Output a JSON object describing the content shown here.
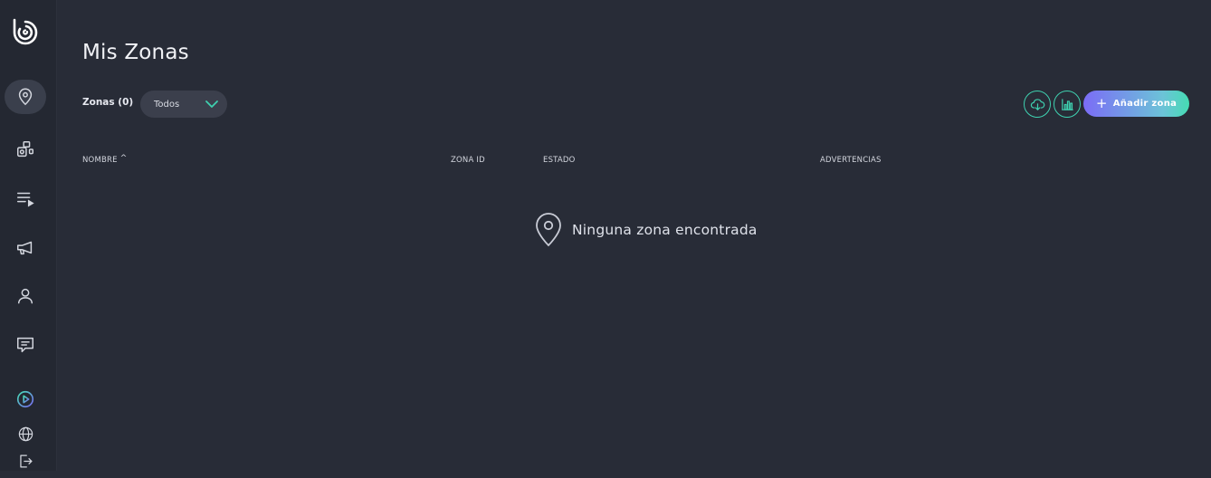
{
  "sidebar": {
    "logo": "brand-logo",
    "items": [
      {
        "name": "zones",
        "icon": "map-pin-icon",
        "active": true
      },
      {
        "name": "devices",
        "icon": "devices-icon",
        "active": false
      },
      {
        "name": "playlists",
        "icon": "playlist-icon",
        "active": false
      },
      {
        "name": "announcements",
        "icon": "megaphone-icon",
        "active": false
      },
      {
        "name": "account",
        "icon": "user-icon",
        "active": false
      },
      {
        "name": "messages",
        "icon": "message-icon",
        "active": false
      }
    ],
    "bottom": [
      "play-icon",
      "globe-icon",
      "logout-icon"
    ]
  },
  "page": {
    "title": "Mis Zonas"
  },
  "toolbar": {
    "zones_label": "Zonas (0)",
    "filter_value": "Todos",
    "download_icon": "cloud-download-icon",
    "stats_icon": "bar-chart-icon",
    "add_label": "Añadir zona"
  },
  "table": {
    "columns": [
      "NOMBRE",
      "ZONA ID",
      "ESTADO",
      "ADVERTENCIAS"
    ],
    "sort_indicator": "^",
    "rows": []
  },
  "empty_state": {
    "icon": "map-pin-icon",
    "text": "Ninguna zona encontrada"
  },
  "colors": {
    "background": "#282c37",
    "sidebar": "#242832",
    "accent": "#3fd1b0",
    "gradient_start": "#7b6cf6",
    "gradient_end": "#45dcb3"
  }
}
